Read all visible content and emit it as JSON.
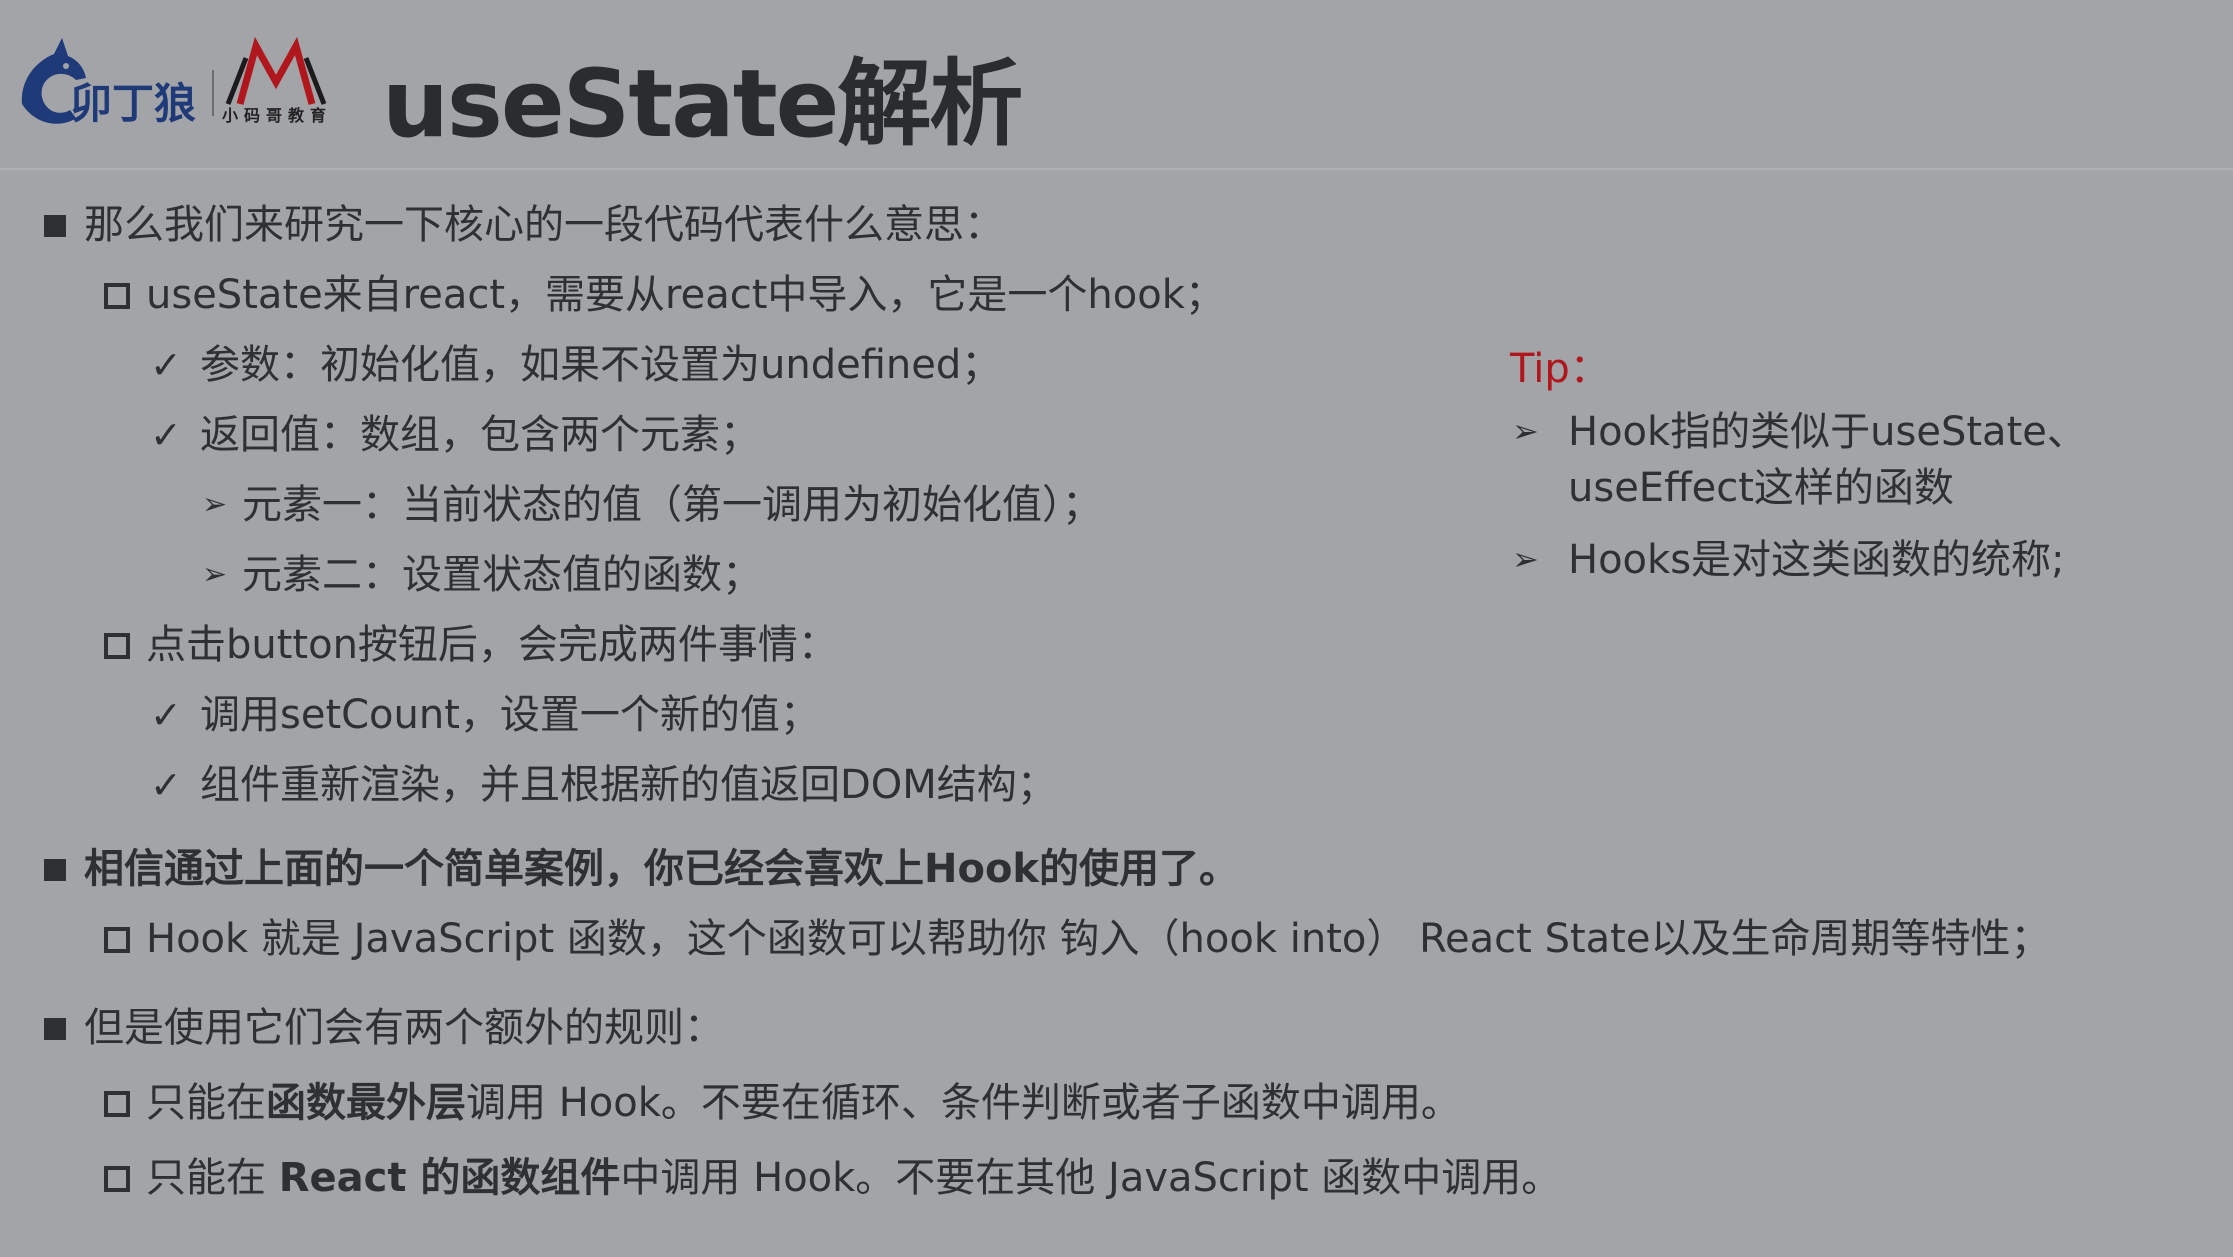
{
  "header": {
    "logo_text": "小码哥教育",
    "title": "useState解析"
  },
  "content": {
    "b1_a": "那么我们来研究一下核心的一段代码代表什么意思：",
    "b2_a": "useState来自react，需要从react中导入，它是一个hook；",
    "b3_a": "参数：初始化值，如果不设置为undefined；",
    "b3_b": "返回值：数组，包含两个元素；",
    "b4_a": "元素一：当前状态的值（第一调用为初始化值）；",
    "b4_b": "元素二：设置状态值的函数；",
    "b2_b": "点击button按钮后，会完成两件事情：",
    "b3_c": "调用setCount，设置一个新的值；",
    "b3_d": "组件重新渲染，并且根据新的值返回DOM结构；",
    "b1_b": "相信通过上面的一个简单案例，你已经会喜欢上Hook的使用了。",
    "b2_c": "Hook 就是 JavaScript 函数，这个函数可以帮助你 钩入（hook into） React State以及生命周期等特性；",
    "b1_c": "但是使用它们会有两个额外的规则：",
    "b2_d_pre": "只能在",
    "b2_d_bold": "函数最外层",
    "b2_d_post": "调用 Hook。不要在循环、条件判断或者子函数中调用。",
    "b2_e_pre": "只能在 ",
    "b2_e_bold": "React 的函数组件",
    "b2_e_post": "中调用 Hook。不要在其他 JavaScript 函数中调用。"
  },
  "tip": {
    "title": "Tip：",
    "items": [
      "Hook指的类似于useState、useEffect这样的函数",
      "Hooks是对这类函数的统称;"
    ]
  },
  "markers": {
    "check": "✓",
    "arrow": "➢"
  },
  "colors": {
    "background": "#a3a4a8",
    "text": "#2f3033",
    "tip": "#b0171c"
  }
}
